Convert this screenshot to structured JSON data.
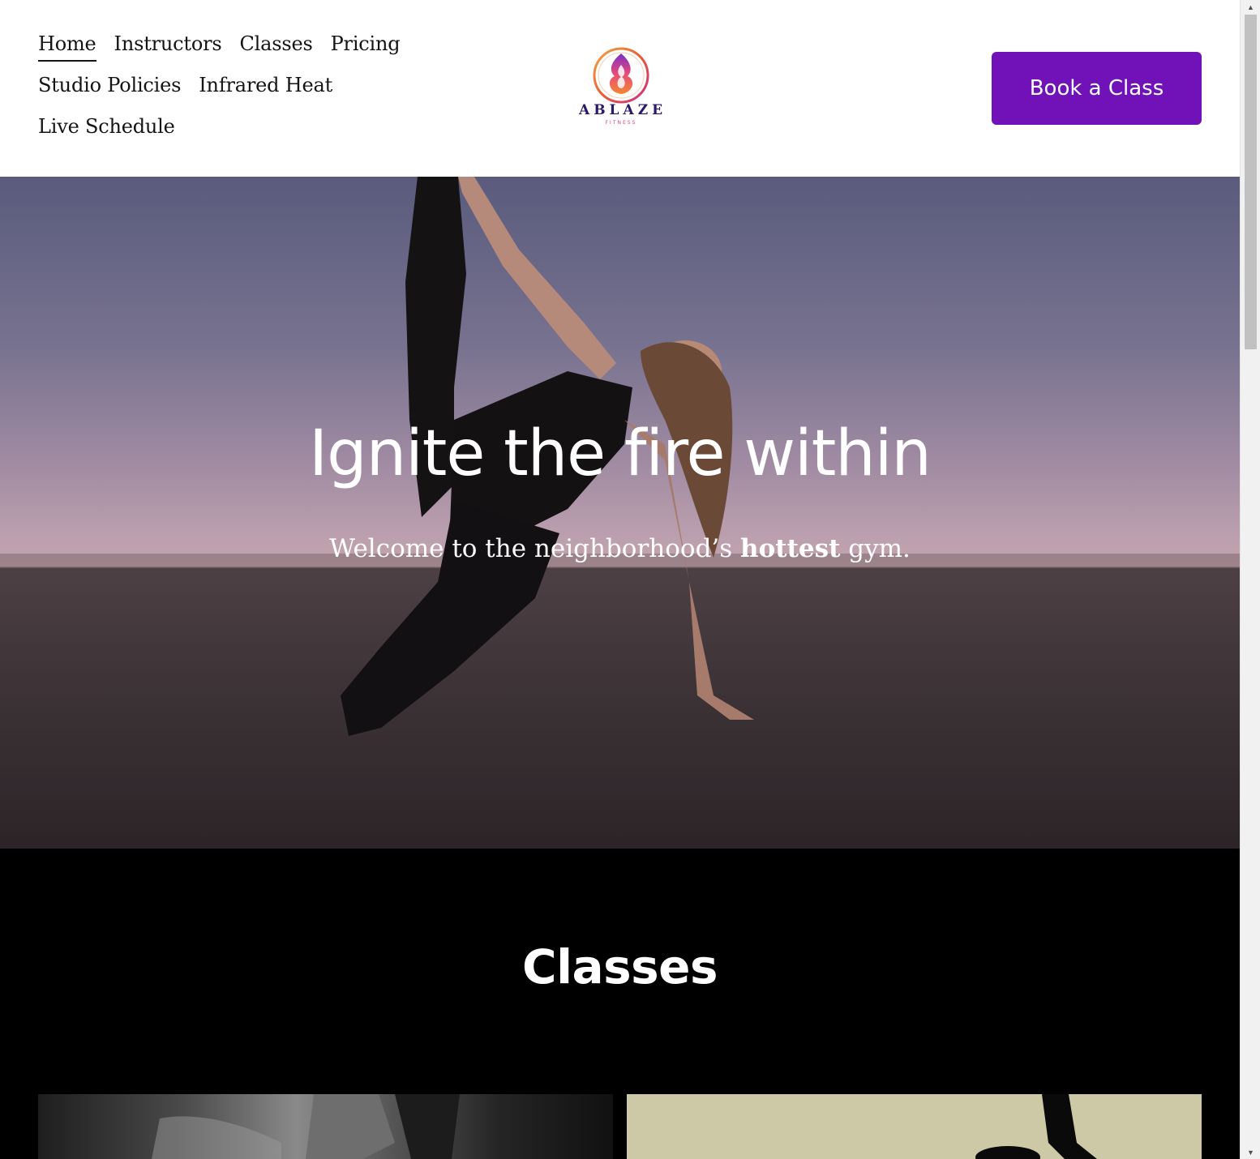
{
  "nav": {
    "rows": [
      [
        {
          "label": "Home",
          "active": true
        },
        {
          "label": "Instructors"
        },
        {
          "label": "Classes"
        },
        {
          "label": "Pricing"
        }
      ],
      [
        {
          "label": "Studio Policies"
        },
        {
          "label": "Infrared Heat"
        }
      ],
      [
        {
          "label": "Live Schedule"
        }
      ]
    ]
  },
  "logo": {
    "wordmark": "ABLAZE",
    "sub": "FITNESS"
  },
  "cta": {
    "label": "Book a Class"
  },
  "hero": {
    "title": "Ignite the fire within",
    "subtitle_before": "Welcome to the neighborhood’s ",
    "subtitle_bold": "hottest",
    "subtitle_after": " gym."
  },
  "classes": {
    "title": "Classes"
  },
  "colors": {
    "accent": "#7012b8",
    "text": "#141414",
    "classes_bg": "#000000",
    "card_tan": "#cdc9a6"
  },
  "icons": {
    "scroll_up": "triangle-up-icon",
    "scroll_down": "triangle-down-icon"
  }
}
